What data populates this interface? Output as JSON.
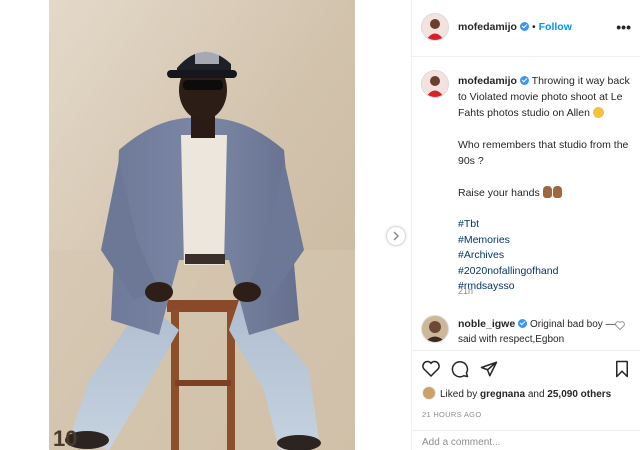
{
  "post": {
    "photo_alt": "",
    "photo_overlay_text": "10"
  },
  "header": {
    "username": "mofedamijo",
    "separator": "•",
    "follow_label": "Follow",
    "more_label": "•••"
  },
  "caption": {
    "username": "mofedamijo",
    "line1": "Throwing it way back to Violated movie photo shoot at Le Fahts photos studio on Allen",
    "line2": "Who remembers that studio from the 90s ?",
    "line3": "Raise your hands",
    "hashtags": [
      "#Tbt",
      "#Memories",
      "#Archives",
      "#2020nofallingofhand",
      "#rmdsaysso"
    ],
    "age": "21h"
  },
  "comment": {
    "username": "noble_igwe",
    "text": "Original bad boy — said with respect,Egbon"
  },
  "likes": {
    "prefix": "Liked by",
    "user": "gregnana",
    "middle": "and",
    "count": "25,090 others"
  },
  "timestamp": "21 HOURS AGO",
  "add_comment_placeholder": "Add a comment...",
  "colors": {
    "link_blue": "#0095f6",
    "hashtag": "#00376b",
    "verified": "#3897f0",
    "muted": "#8e8e8e"
  },
  "icons": {
    "next": "chevron-right-icon",
    "like": "heart-icon",
    "comment": "comment-icon",
    "share": "paper-plane-icon",
    "save": "bookmark-icon"
  }
}
